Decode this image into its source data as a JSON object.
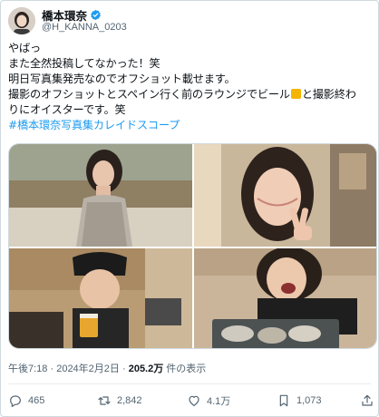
{
  "author": {
    "display_name": "橋本環奈",
    "handle": "@H_KANNA_0203",
    "verified": true
  },
  "tweet": {
    "lines": [
      "やばっ",
      "また全然投稿してなかった！笑",
      "明日写真集発売なのでオフショット載せます。",
      "撮影のオフショットとスペイン行く前のラウンジでビール",
      "と撮影終わ",
      "りにオイスターです。笑"
    ],
    "hashtag": "#橋本環奈写真集カレイドスコープ"
  },
  "media": {
    "photos": [
      {
        "name": "photo-beach-dress"
      },
      {
        "name": "photo-peace-sign"
      },
      {
        "name": "photo-lounge-beer"
      },
      {
        "name": "photo-oysters"
      }
    ]
  },
  "meta": {
    "time": "午後7:18",
    "separator": " · ",
    "date": "2024年2月2日",
    "views": "205.2万",
    "views_suffix": " 件の表示"
  },
  "actions": {
    "replies": "465",
    "retweets": "2,842",
    "likes": "4.1万",
    "bookmarks": "1,073"
  },
  "colors": {
    "accent": "#1d9bf0",
    "secondary_text": "#536471",
    "text": "#0f1419"
  }
}
